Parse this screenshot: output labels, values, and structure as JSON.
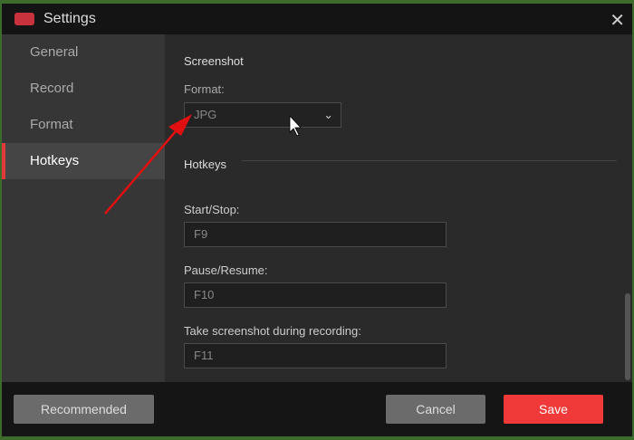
{
  "window": {
    "title": "Settings"
  },
  "sidebar": {
    "items": [
      {
        "label": "General"
      },
      {
        "label": "Record"
      },
      {
        "label": "Format"
      },
      {
        "label": "Hotkeys"
      }
    ]
  },
  "screenshot": {
    "heading": "Screenshot",
    "format_label": "Format:",
    "format_value": "JPG"
  },
  "hotkeys": {
    "heading": "Hotkeys",
    "start_label": "Start/Stop:",
    "start_value": "F9",
    "pause_label": "Pause/Resume:",
    "pause_value": "F10",
    "shot_label": "Take screenshot during recording:",
    "shot_value": "F11"
  },
  "footer": {
    "recommended": "Recommended",
    "cancel": "Cancel",
    "save": "Save"
  },
  "colors": {
    "accent": "#f03a3a"
  }
}
